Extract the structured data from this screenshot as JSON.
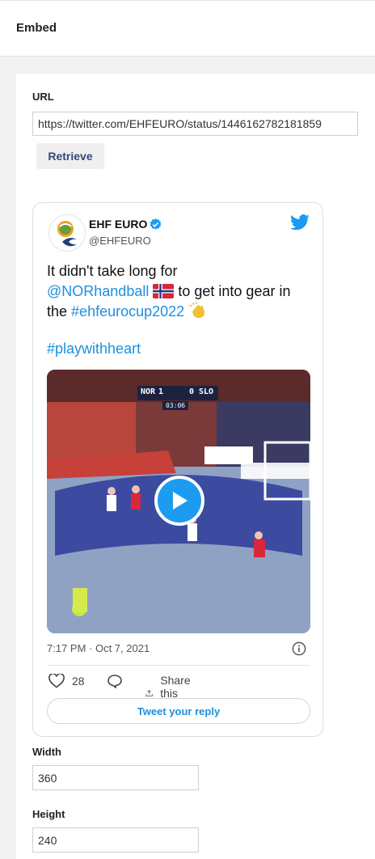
{
  "header": {
    "title": "Embed"
  },
  "url_section": {
    "label": "URL",
    "value": "https://twitter.com/EHFEURO/status/1446162782181859",
    "retrieve_label": "Retrieve"
  },
  "tweet": {
    "author_name": "EHF EURO",
    "handle": "@EHFEURO",
    "text_part1": "It didn't take long for",
    "mention": "@NORhandball",
    "text_part2": "to get into gear in the",
    "hashtag_inline": "#ehfeurocup2022",
    "hashtag": "#playwithheart",
    "video": {
      "scoreboard_home": "NOR",
      "score_home": "1",
      "score_away": "0",
      "scoreboard_away": "SLO",
      "clock": "03:06"
    },
    "timestamp": "7:17 PM · Oct 7, 2021",
    "likes": "28",
    "share_label": "Share this Tweet",
    "reply_label": "Tweet your reply",
    "icons": [
      "verified-icon",
      "twitter-bird-icon",
      "play-icon",
      "info-icon",
      "heart-icon",
      "comment-icon",
      "share-icon"
    ]
  },
  "width_section": {
    "label": "Width",
    "value": "360"
  },
  "height_section": {
    "label": "Height",
    "value": "240"
  },
  "colors": {
    "link": "#1d8fe0",
    "retrieve_text": "#2f4b7c",
    "play": "#1d9bf0"
  }
}
